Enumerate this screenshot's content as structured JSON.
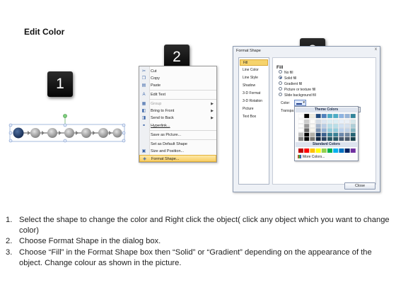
{
  "page": {
    "title": "Edit Color"
  },
  "steps_badges": [
    "1",
    "2",
    "3"
  ],
  "context_menu": {
    "items": [
      {
        "label": "Cut",
        "icon": "scissors-icon",
        "glyph": "✂"
      },
      {
        "label": "Copy",
        "icon": "copy-icon",
        "glyph": "❐"
      },
      {
        "label": "Paste",
        "icon": "paste-icon",
        "glyph": "▤"
      },
      {
        "label": "Edit Text",
        "icon": "edit-text-icon",
        "glyph": "A"
      },
      {
        "label": "Group",
        "icon": "group-icon",
        "glyph": "▦",
        "disabled": true,
        "submenu": true
      },
      {
        "label": "Bring to Front",
        "icon": "bring-front-icon",
        "glyph": "◧",
        "submenu": true
      },
      {
        "label": "Send to Back",
        "icon": "send-back-icon",
        "glyph": "◨",
        "submenu": true
      },
      {
        "label": "Hyperlink...",
        "icon": "hyperlink-icon",
        "glyph": "⚭"
      },
      {
        "label": "Save as Picture...",
        "icon": "",
        "glyph": ""
      },
      {
        "label": "Set as Default Shape",
        "icon": "",
        "glyph": ""
      },
      {
        "label": "Size and Position...",
        "icon": "size-position-icon",
        "glyph": "▣"
      },
      {
        "label": "Format Shape...",
        "icon": "format-shape-icon",
        "glyph": "◈",
        "highlight": true
      }
    ]
  },
  "dialog": {
    "title": "Format Shape",
    "close_glyph": "x",
    "categories": [
      "Fill",
      "Line Color",
      "Line Style",
      "Shadow",
      "3-D Format",
      "3-D Rotation",
      "Picture",
      "Text Box"
    ],
    "selected_category": "Fill",
    "fill_heading": "Fill",
    "fill_options": [
      {
        "label": "No fill",
        "checked": false
      },
      {
        "label": "Solid fill",
        "checked": true
      },
      {
        "label": "Gradient fill",
        "checked": false
      },
      {
        "label": "Picture or texture fill",
        "checked": false
      },
      {
        "label": "Slide background fill",
        "checked": false
      }
    ],
    "color_label": "Color:",
    "transparency_label": "Transpa",
    "close_button": "Close"
  },
  "color_picker": {
    "theme_heading": "Theme Colors",
    "standard_heading": "Standard Colors",
    "more_colors": "More Colors...",
    "theme_top_row": [
      "#ffffff",
      "#000000",
      "#eeece1",
      "#1f497d",
      "#4f81bd",
      "#4bacc6",
      "#4bacc6",
      "#8db3e2",
      "#95b3d7",
      "#31859b"
    ],
    "standard_colors": [
      "#c00000",
      "#ff0000",
      "#ffc000",
      "#ffff00",
      "#92d050",
      "#00b050",
      "#00b0f0",
      "#0070c0",
      "#002060",
      "#7030a0"
    ]
  },
  "instructions": [
    {
      "num": "1.",
      "text": "Select the shape to change the color and Right click the object( click any object which you want to change color)"
    },
    {
      "num": "2.",
      "text": "Choose Format Shape in the dialog box."
    },
    {
      "num": "3.",
      "text": "Choose “Fill” in the Format Shape box then “Solid” or “Gradient” depending on the appearance of the object. Change colour as shown in the picture."
    }
  ],
  "colors": {
    "selected_node": "#1f3b6e",
    "node_gray": "#a9a9a9",
    "menu_highlight": "#f9cd63"
  }
}
